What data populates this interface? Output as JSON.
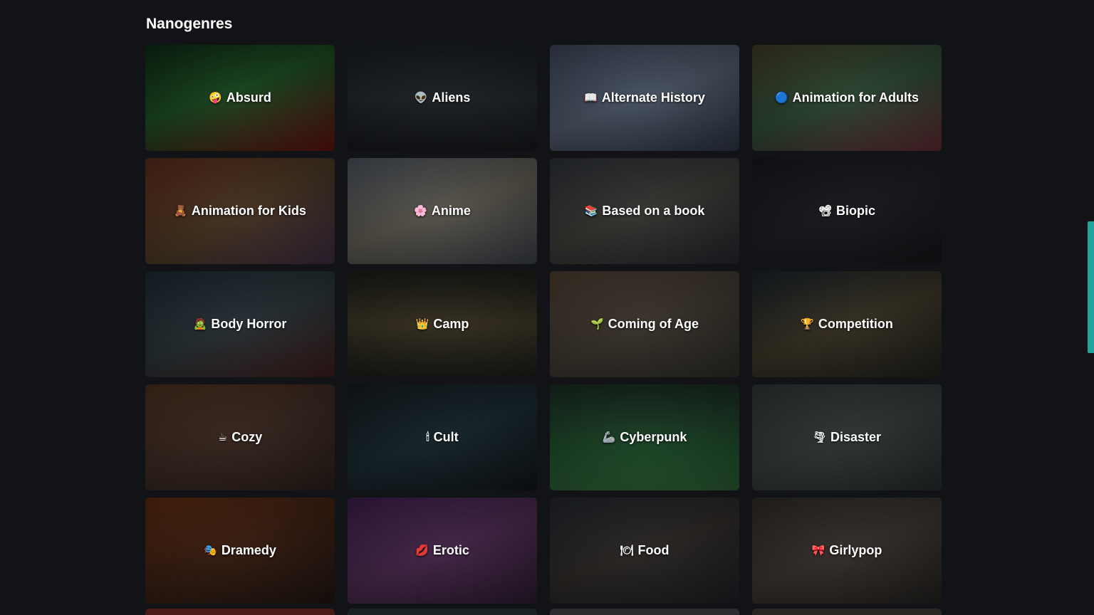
{
  "section": {
    "title": "Nanogenres"
  },
  "genres": [
    {
      "emoji": "🤪",
      "label": "Absurd",
      "bg": "linear-gradient(160deg,#0d2a14 0%,#1c4a22 45%,#5a1010 100%)"
    },
    {
      "emoji": "👽",
      "label": "Aliens",
      "bg": "linear-gradient(180deg,#181c20 0%,#22262b 50%,#15171a 100%)"
    },
    {
      "emoji": "📖",
      "label": "Alternate History",
      "bg": "linear-gradient(160deg,#3a4456 0%,#4e5868 50%,#2a3240 100%)"
    },
    {
      "emoji": "🔵",
      "label": "Animation for Adults",
      "bg": "linear-gradient(160deg,#3e3a24 0%,#2e4a36 50%,#5a2830 100%)"
    },
    {
      "emoji": "🧸",
      "label": "Animation for Kids",
      "bg": "linear-gradient(150deg,#5a2a1c 0%,#4a3824 50%,#3a2a3e 100%)"
    },
    {
      "emoji": "🌸",
      "label": "Anime",
      "bg": "linear-gradient(160deg,#4a505a 0%,#5e5a50 50%,#383c44 100%)"
    },
    {
      "emoji": "📚",
      "label": "Based on a book",
      "bg": "linear-gradient(160deg,#2c3036 0%,#3c3a36 50%,#22252a 100%)"
    },
    {
      "emoji": "📽",
      "label": "Biopic",
      "bg": "linear-gradient(160deg,#16181c 0%,#1c1e22 50%,#141518 100%)"
    },
    {
      "emoji": "🧟",
      "label": "Body Horror",
      "bg": "linear-gradient(160deg,#1c2a30 0%,#2a3438 50%,#3a1c1c 100%)"
    },
    {
      "emoji": "👑",
      "label": "Camp",
      "bg": "linear-gradient(180deg,#1a1c18 0%,#3a3424 50%,#1a1c18 100%)"
    },
    {
      "emoji": "🌱",
      "label": "Coming of Age",
      "bg": "linear-gradient(160deg,#4a3c30 0%,#3e3830 50%,#2a2a26 100%)"
    },
    {
      "emoji": "🏆",
      "label": "Competition",
      "bg": "linear-gradient(160deg,#1a2228 0%,#3a3426 50%,#1e1e1a 100%)"
    },
    {
      "emoji": "☕",
      "label": "Cozy",
      "bg": "linear-gradient(160deg,#4a2e20 0%,#3a2a22 50%,#2a1e1a 100%)"
    },
    {
      "emoji": "🕯",
      "label": "Cult",
      "bg": "linear-gradient(160deg,#141a1e 0%,#1a2a30 50%,#101418 100%)"
    },
    {
      "emoji": "🦾",
      "label": "Cyberpunk",
      "bg": "linear-gradient(180deg,#1a2a22 0%,#1e4a2a 60%,#2a5a34 100%)"
    },
    {
      "emoji": "🌪",
      "label": "Disaster",
      "bg": "linear-gradient(160deg,#2e3434 0%,#343a3a 50%,#262a2a 100%)"
    },
    {
      "emoji": "🎭",
      "label": "Dramedy",
      "bg": "linear-gradient(160deg,#5a2a10 0%,#3a2014 50%,#1e1410 100%)"
    },
    {
      "emoji": "💋",
      "label": "Erotic",
      "bg": "linear-gradient(160deg,#3a1e4a 0%,#4a2a4e 50%,#2a1a2e 100%)"
    },
    {
      "emoji": "🍽",
      "label": "Food",
      "bg": "linear-gradient(160deg,#22262c 0%,#2e2a28 50%,#1c1e22 100%)"
    },
    {
      "emoji": "🎀",
      "label": "Girlypop",
      "bg": "linear-gradient(160deg,#2e2a26 0%,#3a3430 50%,#22201e 100%)"
    }
  ],
  "partial_row": [
    {
      "bg": "#4a1a1a"
    },
    {
      "bg": "#1a2226"
    },
    {
      "bg": "#2e2e30"
    },
    {
      "bg": "#2a2622"
    }
  ],
  "scroll_indicator_color": "#1fa39a"
}
